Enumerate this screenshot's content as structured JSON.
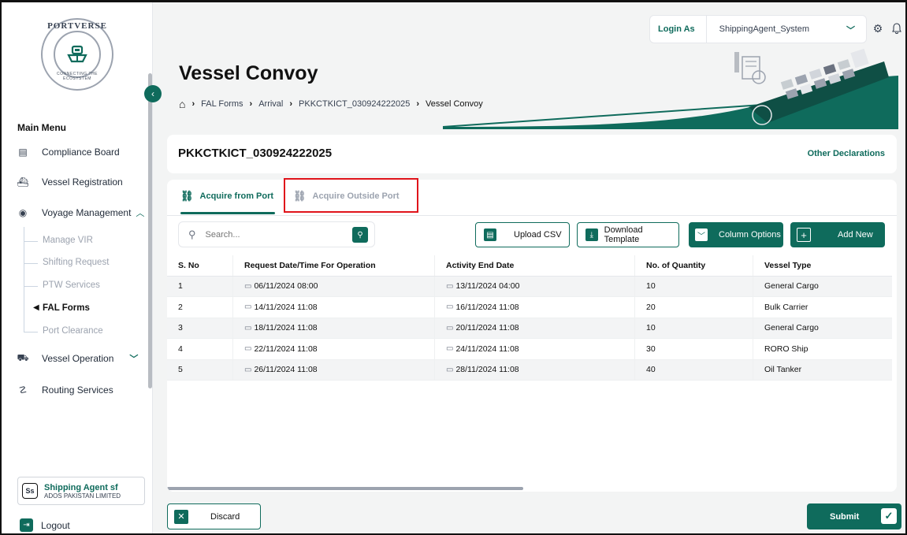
{
  "brand": {
    "logo_top": "PORTVERSE",
    "logo_bottom": "CONNECTING THE ECOSYSTEM"
  },
  "topbar": {
    "login_label": "Login As",
    "login_user": "ShippingAgent_System"
  },
  "sidebar": {
    "main_menu": "Main Menu",
    "items": [
      {
        "label": "Compliance Board",
        "icon": "clipboard-icon"
      },
      {
        "label": "Vessel Registration",
        "icon": "ship-icon"
      },
      {
        "label": "Voyage Management",
        "icon": "compass-icon"
      },
      {
        "label": "Vessel Operation",
        "icon": "operation-icon"
      },
      {
        "label": "Routing Services",
        "icon": "route-icon"
      }
    ],
    "sub_items": [
      {
        "label": "Manage VIR"
      },
      {
        "label": "Shifting Request"
      },
      {
        "label": "PTW Services"
      },
      {
        "label": "FAL Forms"
      },
      {
        "label": "Port Clearance"
      }
    ],
    "user": {
      "initials": "Ss",
      "name": "Shipping Agent sf",
      "org": "ADOS PAKISTAN LIMITED"
    },
    "logout": "Logout"
  },
  "header": {
    "title": "Vessel Convoy",
    "breadcrumb": [
      "FAL Forms",
      "Arrival",
      "PKKCTKICT_030924222025",
      "Vessel Convoy"
    ]
  },
  "declaration": {
    "id": "PKKCTKICT_030924222025",
    "other_link": "Other Declarations"
  },
  "tabs": [
    {
      "label": "Acquire from Port"
    },
    {
      "label": "Acquire Outside Port"
    }
  ],
  "toolbar": {
    "search_placeholder": "Search...",
    "upload_csv": "Upload CSV",
    "download_template": "Download Template",
    "column_options": "Column Options",
    "add_new": "Add New"
  },
  "table": {
    "columns": [
      "S. No",
      "Request Date/Time For Operation",
      "Activity End Date",
      "No. of Quantity",
      "Vessel Type"
    ],
    "rows": [
      [
        "1",
        "06/11/2024 08:00",
        "13/11/2024 04:00",
        "10",
        "General Cargo"
      ],
      [
        "2",
        "14/11/2024 11:08",
        "16/11/2024 11:08",
        "20",
        "Bulk Carrier"
      ],
      [
        "3",
        "18/11/2024 11:08",
        "20/11/2024 11:08",
        "10",
        "General Cargo"
      ],
      [
        "4",
        "22/11/2024 11:08",
        "24/11/2024 11:08",
        "30",
        "RORO Ship"
      ],
      [
        "5",
        "26/11/2024 11:08",
        "28/11/2024 11:08",
        "40",
        "Oil Tanker"
      ]
    ]
  },
  "footer": {
    "discard": "Discard",
    "submit": "Submit"
  },
  "colors": {
    "accent": "#0f6b5c",
    "highlight": "#e0141b"
  }
}
